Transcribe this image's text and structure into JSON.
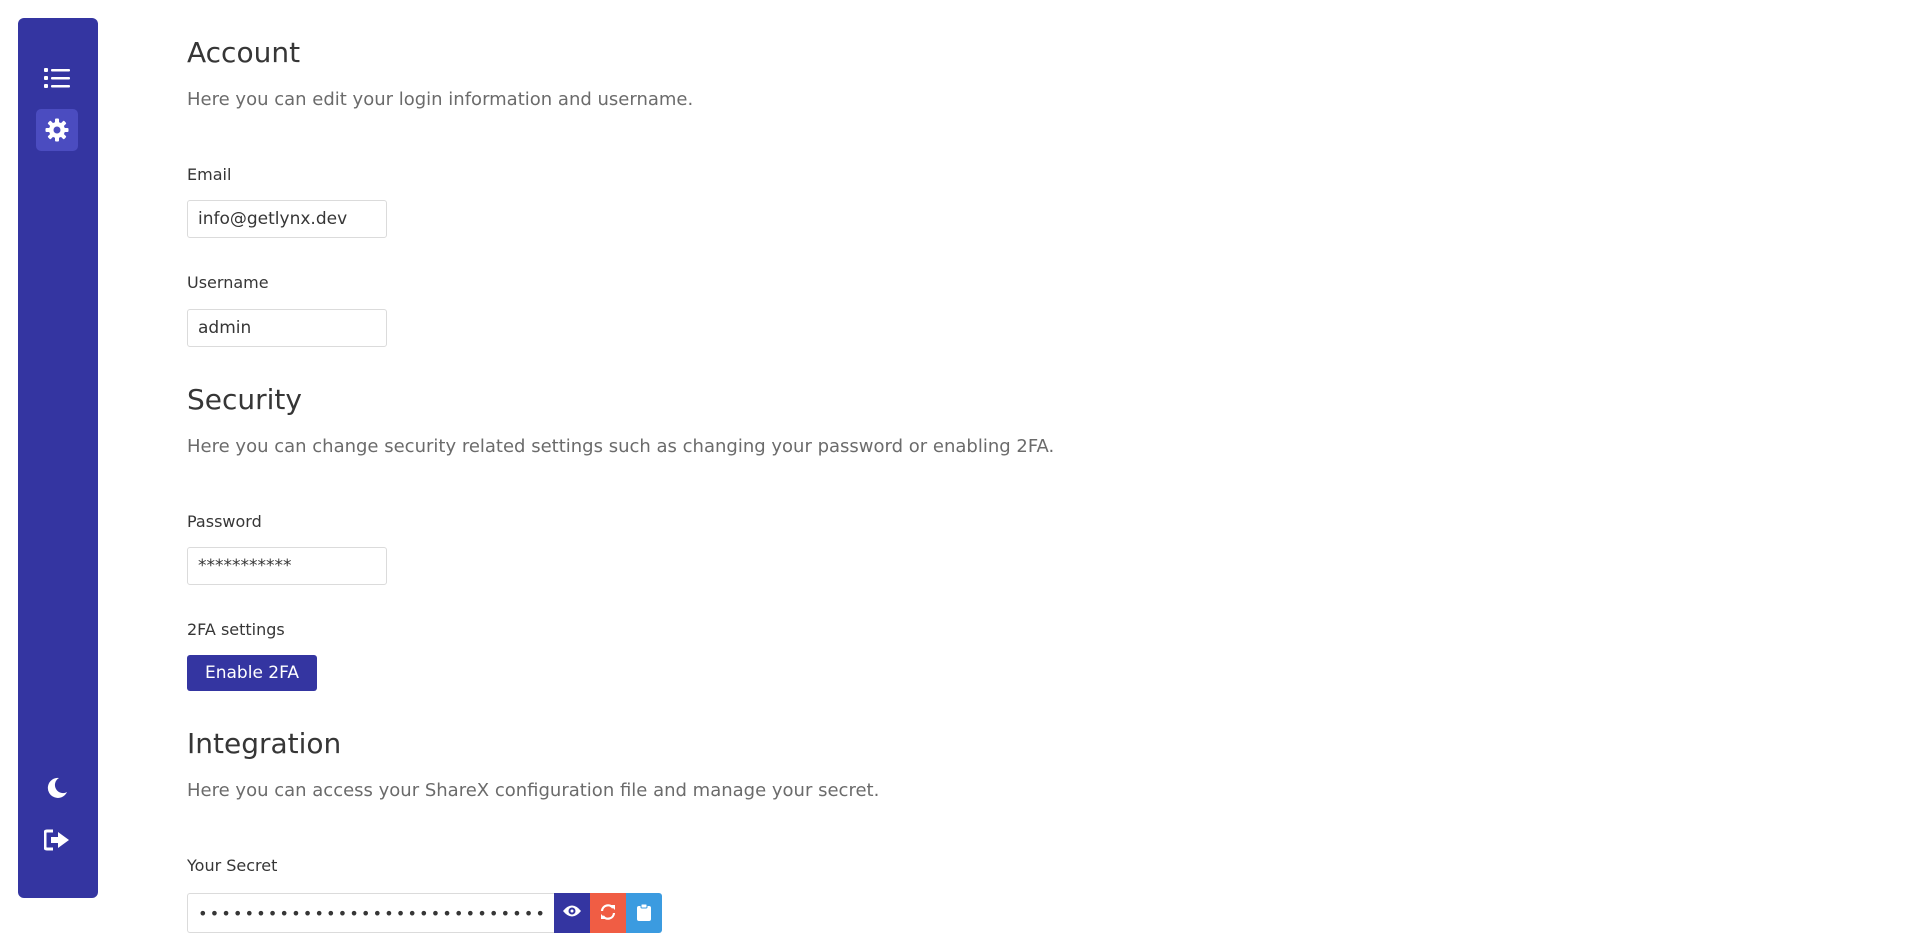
{
  "sidebar": {
    "items": [
      {
        "icon": "list-icon",
        "active": false
      },
      {
        "icon": "gear-icon",
        "active": true
      },
      {
        "icon": "moon-icon",
        "active": false
      },
      {
        "icon": "sign-out-icon",
        "active": false
      }
    ],
    "color": "#3435a1"
  },
  "account": {
    "title": "Account",
    "description": "Here you can edit your login information and username.",
    "email_label": "Email",
    "email_value": "info@getlynx.dev",
    "username_label": "Username",
    "username_value": "admin"
  },
  "security": {
    "title": "Security",
    "description": "Here you can change security related settings such as changing your password or enabling 2FA.",
    "password_label": "Password",
    "password_value": "***********",
    "twofa_label": "2FA settings",
    "twofa_button": "Enable 2FA"
  },
  "integration": {
    "title": "Integration",
    "description": "Here you can access your ShareX configuration file and manage your secret.",
    "secret_label": "Your Secret",
    "secret_value": "••••••••••••••••••••••••••••••••",
    "buttons": [
      "eye-icon",
      "refresh-icon",
      "clipboard-icon"
    ]
  }
}
